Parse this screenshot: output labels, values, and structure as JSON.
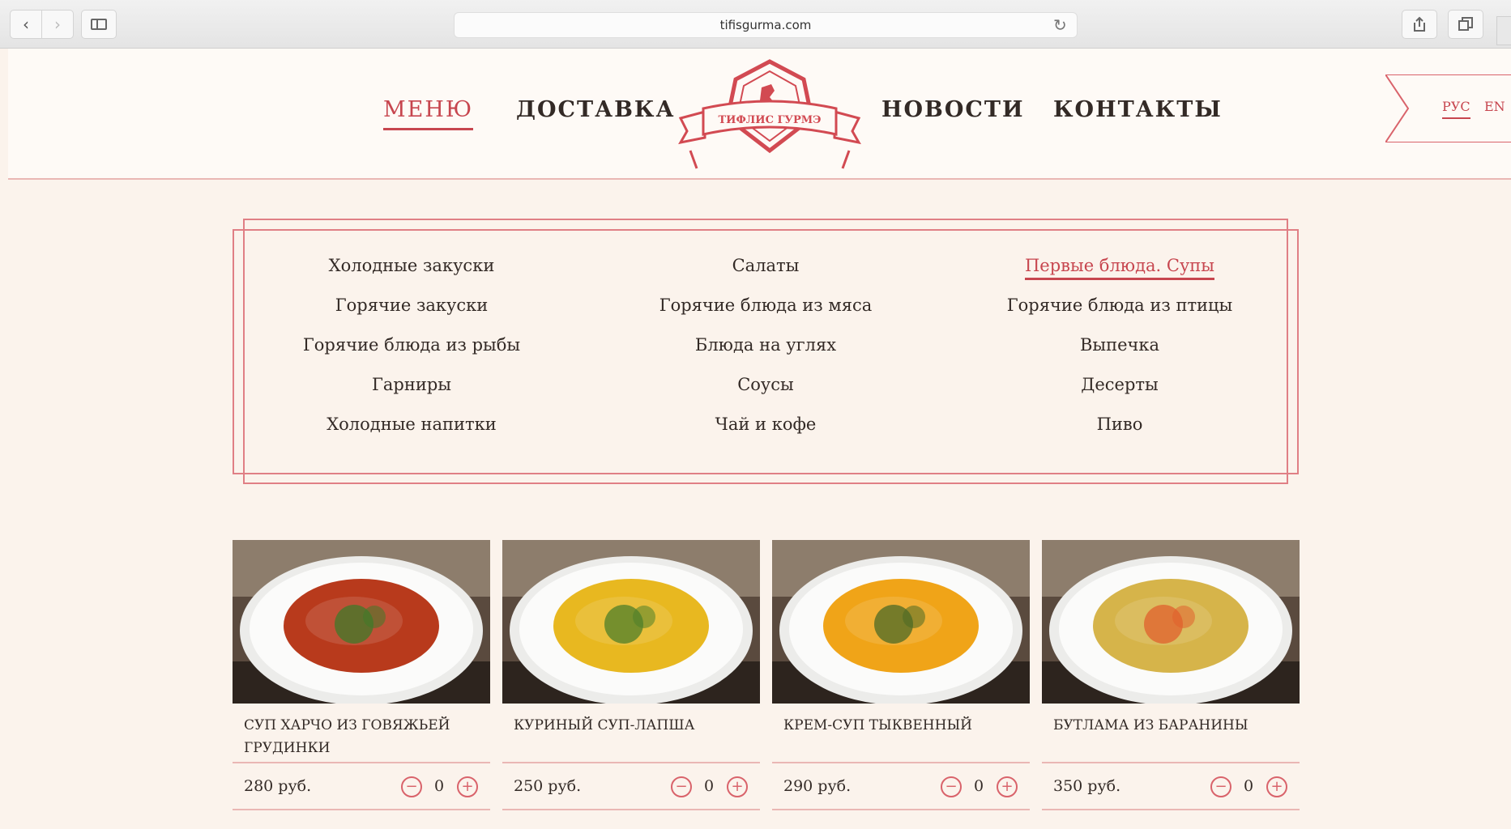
{
  "browser": {
    "url": "tifisgurma.com",
    "back_icon": "chevron-left-icon",
    "forward_icon": "chevron-right-icon",
    "reload_icon": "reload-icon"
  },
  "header": {
    "nav_left": [
      "МЕНЮ",
      "ДОСТАВКА"
    ],
    "nav_right": [
      "НОВОСТИ",
      "КОНТАКТЫ"
    ],
    "active_nav": "МЕНЮ",
    "logo_text": "ТИФЛИС ГУРМЭ",
    "lang": {
      "ru": "РУС",
      "en": "EN",
      "active": "РУС"
    }
  },
  "categories": {
    "columns": [
      [
        "Холодные закуски",
        "Горячие закуски",
        "Горячие блюда из рыбы",
        "Гарниры",
        "Холодные напитки"
      ],
      [
        "Салаты",
        "Горячие блюда из мяса",
        "Блюда на углях",
        "Соусы",
        "Чай и кофе"
      ],
      [
        "Первые блюда. Супы",
        "Горячие блюда из птицы",
        "Выпечка",
        "Десерты",
        "Пиво"
      ]
    ],
    "active": "Первые блюда. Супы"
  },
  "products": [
    {
      "name": "Суп харчо из говяжьей грудинки",
      "price": "280 руб.",
      "qty": "0",
      "soup_color": "#b83a1c",
      "garnish": "#3f7a2a"
    },
    {
      "name": "Куриный суп-лапша",
      "price": "250 руб.",
      "qty": "0",
      "soup_color": "#e8b820",
      "garnish": "#4d7f2a"
    },
    {
      "name": "Крем-суп тыквенный",
      "price": "290 руб.",
      "qty": "0",
      "soup_color": "#f0a418",
      "garnish": "#4b6a25"
    },
    {
      "name": "Бутлама из баранины",
      "price": "350 руб.",
      "qty": "0",
      "soup_color": "#d6b44a",
      "garnish": "#e0602c"
    }
  ],
  "colors": {
    "accent": "#c7464f",
    "border": "#e07f85",
    "background": "#fbf3ec"
  }
}
